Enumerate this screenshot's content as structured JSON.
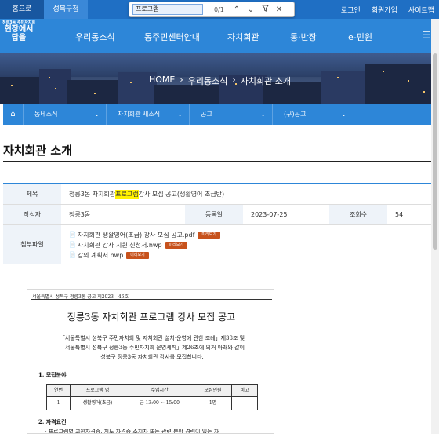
{
  "topbar": {
    "home": "홈으로",
    "district": "성북구청",
    "login": "로그인",
    "signup": "회원가입",
    "sitemap": "사이트맵"
  },
  "findbar": {
    "query": "프로그램",
    "count": "0/1",
    "up_icon": "chevron-up-icon",
    "down_icon": "chevron-down-icon",
    "filter_icon": "filter-icon",
    "close_icon": "close-icon"
  },
  "logo": {
    "line1": "정릉3동 주민자치회",
    "line2": "현장에서",
    "line3": "답을"
  },
  "nav": {
    "items": [
      "우리동소식",
      "동주민센터안내",
      "자치회관",
      "통·반장",
      "e-민원"
    ]
  },
  "breadcrumb": [
    "HOME",
    "우리동소식",
    "자치회관 소개"
  ],
  "subnav": {
    "items": [
      "동네소식",
      "자치회관 새소식",
      "공고",
      "(구)공고"
    ]
  },
  "page_title": "자치회관 소개",
  "info": {
    "labels": {
      "title": "제목",
      "author": "작성자",
      "date": "등록일",
      "views": "조회수",
      "attach": "첨부파일"
    },
    "title_pre": "정릉3동 자치회관 ",
    "title_hl": "프로그램",
    "title_post": " 강사 모집 공고(생활영어 초급반)",
    "author": "정릉3동",
    "date": "2023-07-25",
    "views": "54",
    "attachments": [
      "자치회관 생활영어(초급) 강사 모집 공고.pdf",
      "자치회관 강사 지원 신청서.hwp",
      "강의 계획서.hwp"
    ],
    "preview_label": "미리보기"
  },
  "doc": {
    "header": "서울특별시 성북구 정릉3동 공고 제2023 - 46호",
    "title": "정릉3동 자치회관 프로그램 강사 모집 공고",
    "para1": "「서울특별시 성북구 주민자치회 및 자치회관 설치·운영에 관한 조례」제38조 및",
    "para2": "「서울특별시 성북구 정릉3동 주민자치회 운영세칙」제26조에 의거 아래와 같이",
    "para3": "성북구 정릉3동 자치회관 강사를 모집합니다.",
    "sec1": "1. 모집분야",
    "table_head": [
      "연번",
      "프로그램 명",
      "수업시간",
      "모집인원",
      "비고"
    ],
    "table_row": [
      "1",
      "생활영어(초급)",
      "금 13:00 ~ 15:00",
      "1명",
      ""
    ],
    "sec2": "2. 자격요건",
    "sec2_line": "- 프로그램별 교원자격증, 지도 자격증 소지자 또는 관련 분야 경력이 있는 자"
  },
  "colors": {
    "topbar": "#1f6fc4",
    "nav": "#2d86d8",
    "highlight": "#fff200",
    "preview_btn": "#c7521c"
  }
}
